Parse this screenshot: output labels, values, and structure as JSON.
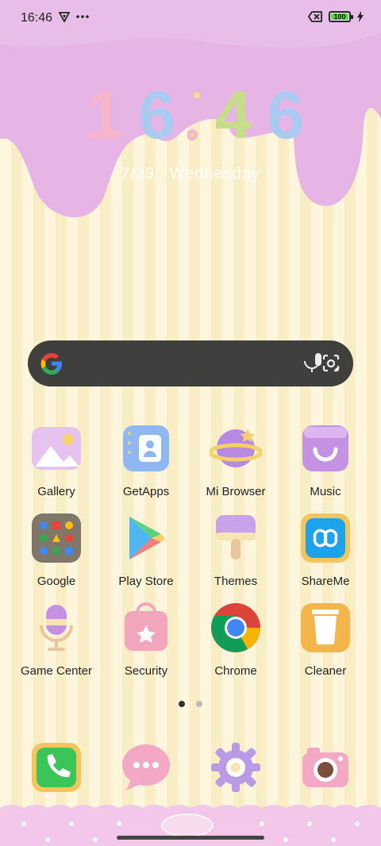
{
  "status_bar": {
    "time": "16:46",
    "battery_level": "100"
  },
  "lockclock": {
    "digits": [
      "1",
      "6",
      "4",
      "6"
    ],
    "digit_colors": [
      "#f6b5c8",
      "#aacbf0",
      "#c8dd88",
      "#aacbf0"
    ],
    "date": "7/29",
    "weekday": "Wednesday"
  },
  "search": {
    "icon_left": "google-icon",
    "icon_mic": "mic-icon",
    "icon_lens": "lens-icon"
  },
  "apps": [
    {
      "label": "Gallery",
      "icon": "gallery-icon"
    },
    {
      "label": "GetApps",
      "icon": "getapps-icon"
    },
    {
      "label": "Mi Browser",
      "icon": "browser-icon"
    },
    {
      "label": "Music",
      "icon": "music-icon"
    },
    {
      "label": "Google",
      "icon": "google-folder-icon"
    },
    {
      "label": "Play Store",
      "icon": "play-store-icon"
    },
    {
      "label": "Themes",
      "icon": "themes-icon"
    },
    {
      "label": "ShareMe",
      "icon": "shareme-icon"
    },
    {
      "label": "Game Center",
      "icon": "game-center-icon"
    },
    {
      "label": "Security",
      "icon": "security-icon"
    },
    {
      "label": "Chrome",
      "icon": "chrome-icon"
    },
    {
      "label": "Cleaner",
      "icon": "cleaner-icon"
    }
  ],
  "dock": [
    {
      "icon": "phone-icon"
    },
    {
      "icon": "messages-icon"
    },
    {
      "icon": "settings-icon"
    },
    {
      "icon": "camera-icon"
    }
  ],
  "page_indicator": {
    "count": 2,
    "active": 0
  },
  "colors": {
    "drip": "#e7b4e6",
    "background": "#fdf6dc",
    "search_bar": "#3f3f3e"
  }
}
